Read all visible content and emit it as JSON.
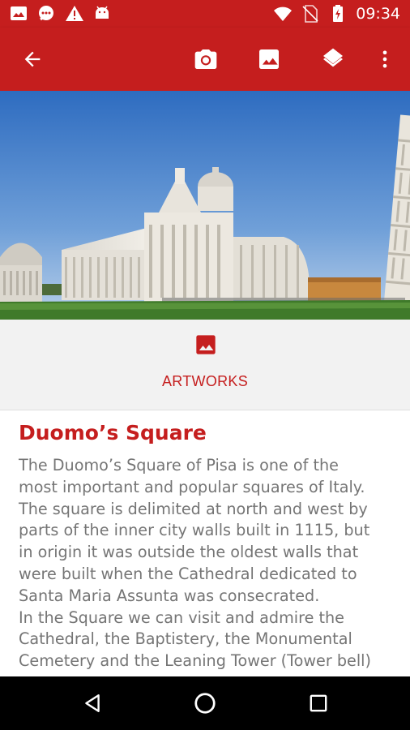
{
  "status_bar": {
    "time": "09:34",
    "icons": [
      "gallery-notification-icon",
      "chat-notification-icon",
      "warning-icon",
      "android-icon",
      "wifi-icon",
      "no-sim-icon",
      "battery-charging-icon"
    ]
  },
  "app_bar": {
    "actions": [
      "back-arrow-icon",
      "camera-icon",
      "image-icon",
      "layers-icon",
      "more-vert-icon"
    ]
  },
  "hero": {
    "subject": "Piazza del Duomo, Pisa - Cathedral, Baptistery and Leaning Tower"
  },
  "tab": {
    "icon": "image-icon",
    "label": "ARTWORKS"
  },
  "article": {
    "title": "Duomo’s Square",
    "body": "The Duomo’s Square of Pisa is one of the\nmost important and popular squares of Italy.\nThe square is delimited at north and west by\nparts of the inner city walls built in 1115, but\nin origin it was outside the oldest walls that\nwere built when the Cathedral dedicated to\nSanta Maria Assunta was consecrated.\nIn the Square we can visit and admire the\nCathedral, the Baptistery, the Monumental\nCemetery and the Leaning Tower (Tower bell)"
  },
  "nav_bar": {
    "buttons": [
      "back-triangle-icon",
      "home-circle-icon",
      "recents-square-icon"
    ]
  },
  "colors": {
    "primary": "#c51e1e",
    "text_secondary": "#757575",
    "background": "#f2f2f2"
  }
}
